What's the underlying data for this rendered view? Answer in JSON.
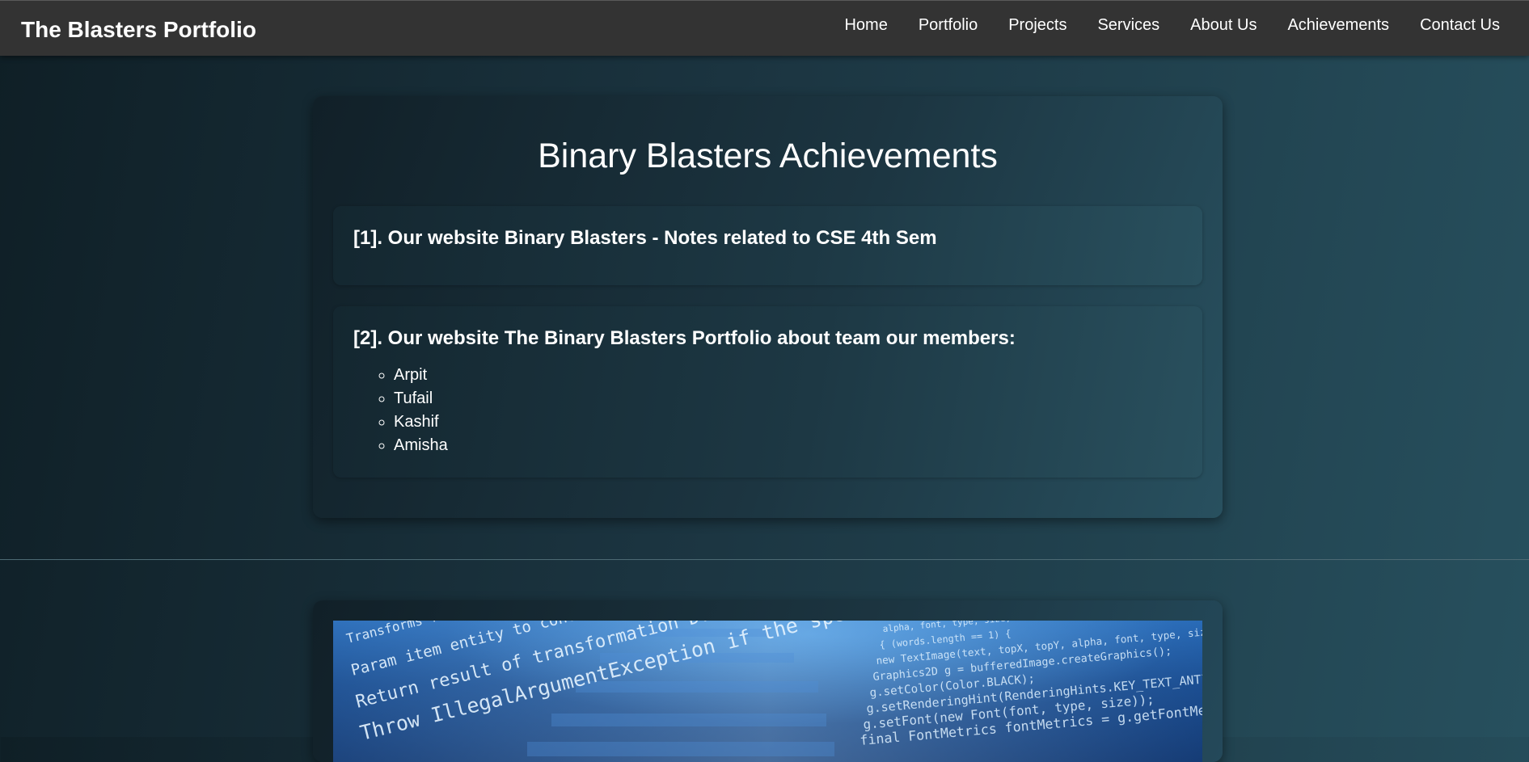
{
  "navbar": {
    "brand": "The Blasters Portfolio",
    "links": [
      "Home",
      "Portfolio",
      "Projects",
      "Services",
      "About Us",
      "Achievements",
      "Contact Us"
    ]
  },
  "achievements": {
    "title": "Binary Blasters Achievements",
    "items": [
      {
        "heading": "[1]. Our website Binary Blasters - Notes related to CSE 4th Sem"
      },
      {
        "heading": "[2]. Our website The Binary Blasters Portfolio about team our members:",
        "members": [
          "Arpit",
          "Tufail",
          "Kashif",
          "Amisha"
        ]
      }
    ]
  },
  "image": {
    "code_lines_left": [
      "Transforms from Entity to DTO.",
      "Param item entity to convert",
      "Return result of transformation DTO or <code>null</code>",
      "Throw IllegalArgumentException if the specified object is"
    ],
    "code_lines_right": [
      "alpha, font, type, size, co",
      "{ (words.length == 1) {",
      "new TextImage(text, topX, topY, alpha, font, type, size,",
      "Graphics2D g = bufferedImage.createGraphics();",
      "g.setColor(Color.BLACK);",
      "g.setRenderingHint(RenderingHints.KEY_TEXT_ANTIALIASING, Renderin",
      "g.setFont(new Font(font, type, size));",
      "final FontMetrics fontMetrics = g.getFontMetrics();"
    ]
  }
}
